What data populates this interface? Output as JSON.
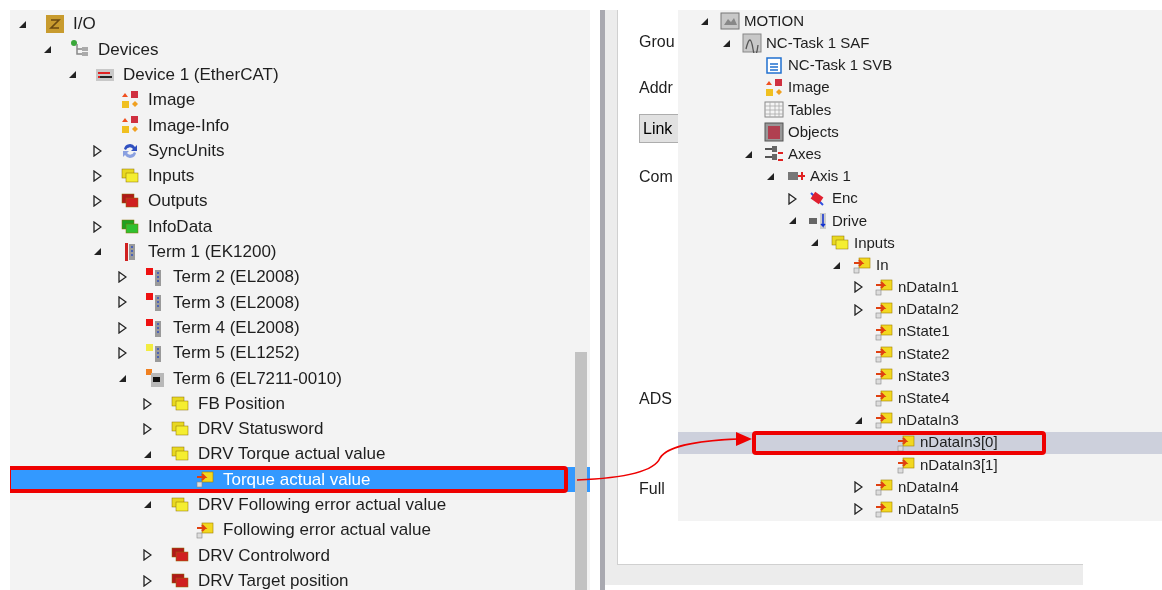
{
  "left_tree": {
    "items": [
      {
        "label": "I/O",
        "kind": "io",
        "expanded": true,
        "selected": false,
        "highlighted": false,
        "children": [
          {
            "label": "Devices",
            "kind": "devices",
            "expanded": true,
            "selected": false,
            "highlighted": false,
            "children": [
              {
                "label": "Device 1 (EtherCAT)",
                "kind": "device",
                "expanded": true,
                "selected": false,
                "highlighted": false,
                "children": [
                  {
                    "label": "Image",
                    "kind": "image",
                    "selected": false,
                    "highlighted": false
                  },
                  {
                    "label": "Image-Info",
                    "kind": "image",
                    "selected": false,
                    "highlighted": false
                  },
                  {
                    "label": "SyncUnits",
                    "kind": "sync",
                    "expanded": false,
                    "selected": false,
                    "highlighted": false
                  },
                  {
                    "label": "Inputs",
                    "kind": "inputs",
                    "expanded": false,
                    "selected": false,
                    "highlighted": false
                  },
                  {
                    "label": "Outputs",
                    "kind": "outputs",
                    "expanded": false,
                    "selected": false,
                    "highlighted": false
                  },
                  {
                    "label": "InfoData",
                    "kind": "info",
                    "expanded": false,
                    "selected": false,
                    "highlighted": false
                  },
                  {
                    "label": "Term 1 (EK1200)",
                    "kind": "coupler",
                    "expanded": true,
                    "selected": false,
                    "highlighted": false,
                    "children": [
                      {
                        "label": "Term 2 (EL2008)",
                        "kind": "term-out",
                        "expanded": false,
                        "selected": false,
                        "highlighted": false
                      },
                      {
                        "label": "Term 3 (EL2008)",
                        "kind": "term-out",
                        "expanded": false,
                        "selected": false,
                        "highlighted": false
                      },
                      {
                        "label": "Term 4 (EL2008)",
                        "kind": "term-out",
                        "expanded": false,
                        "selected": false,
                        "highlighted": false
                      },
                      {
                        "label": "Term 5 (EL1252)",
                        "kind": "term-in",
                        "expanded": false,
                        "selected": false,
                        "highlighted": false
                      },
                      {
                        "label": "Term 6 (EL7211-0010)",
                        "kind": "term-drive",
                        "expanded": true,
                        "selected": false,
                        "highlighted": false,
                        "children": [
                          {
                            "label": "FB Position",
                            "kind": "inputs",
                            "expanded": false,
                            "selected": false,
                            "highlighted": false
                          },
                          {
                            "label": "DRV Statusword",
                            "kind": "inputs",
                            "expanded": false,
                            "selected": false,
                            "highlighted": false
                          },
                          {
                            "label": "DRV Torque actual value",
                            "kind": "inputs",
                            "expanded": true,
                            "selected": false,
                            "highlighted": false,
                            "children": [
                              {
                                "label": "Torque actual value",
                                "kind": "variable",
                                "selected": true,
                                "highlighted": true
                              }
                            ]
                          },
                          {
                            "label": "DRV Following error actual value",
                            "kind": "inputs",
                            "expanded": true,
                            "selected": false,
                            "highlighted": false,
                            "children": [
                              {
                                "label": "Following error actual value",
                                "kind": "variable",
                                "selected": false,
                                "highlighted": false
                              }
                            ]
                          },
                          {
                            "label": "DRV Controlword",
                            "kind": "outputs",
                            "expanded": false,
                            "selected": false,
                            "highlighted": false
                          },
                          {
                            "label": "DRV Target position",
                            "kind": "outputs",
                            "expanded": false,
                            "selected": false,
                            "highlighted": false
                          }
                        ]
                      }
                    ]
                  }
                ]
              }
            ]
          }
        ]
      }
    ]
  },
  "properties": [
    {
      "kind": "label",
      "text": "Grou"
    },
    {
      "kind": "label",
      "text": "Addr"
    },
    {
      "kind": "button",
      "text": "Link"
    },
    {
      "kind": "label",
      "text": "Com"
    },
    {
      "kind": "label",
      "text": "ADS"
    },
    {
      "kind": "label",
      "text": "Full"
    }
  ],
  "right_tree": {
    "items": [
      {
        "label": "MOTION",
        "kind": "motion",
        "expanded": true,
        "selected": false,
        "highlighted": false,
        "children": [
          {
            "label": "NC-Task 1 SAF",
            "kind": "nctask",
            "expanded": true,
            "selected": false,
            "highlighted": false,
            "children": [
              {
                "label": "NC-Task 1 SVB",
                "kind": "svb",
                "selected": false,
                "highlighted": false
              },
              {
                "label": "Image",
                "kind": "image",
                "selected": false,
                "highlighted": false
              },
              {
                "label": "Tables",
                "kind": "tables",
                "selected": false,
                "highlighted": false
              },
              {
                "label": "Objects",
                "kind": "objects",
                "selected": false,
                "highlighted": false
              },
              {
                "label": "Axes",
                "kind": "axes",
                "expanded": true,
                "selected": false,
                "highlighted": false,
                "children": [
                  {
                    "label": "Axis 1",
                    "kind": "axis",
                    "expanded": true,
                    "selected": false,
                    "highlighted": false,
                    "children": [
                      {
                        "label": "Enc",
                        "kind": "enc",
                        "expanded": false,
                        "selected": false,
                        "highlighted": false
                      },
                      {
                        "label": "Drive",
                        "kind": "drive",
                        "expanded": true,
                        "selected": false,
                        "highlighted": false,
                        "children": [
                          {
                            "label": "Inputs",
                            "kind": "inputs",
                            "expanded": true,
                            "selected": false,
                            "highlighted": false,
                            "children": [
                              {
                                "label": "In",
                                "kind": "variable",
                                "expanded": true,
                                "selected": false,
                                "highlighted": false,
                                "children": [
                                  {
                                    "label": "nDataIn1",
                                    "kind": "variable",
                                    "expanded": false,
                                    "selected": false,
                                    "highlighted": false
                                  },
                                  {
                                    "label": "nDataIn2",
                                    "kind": "variable",
                                    "expanded": false,
                                    "selected": false,
                                    "highlighted": false
                                  },
                                  {
                                    "label": "nState1",
                                    "kind": "variable",
                                    "selected": false,
                                    "highlighted": false
                                  },
                                  {
                                    "label": "nState2",
                                    "kind": "variable",
                                    "selected": false,
                                    "highlighted": false
                                  },
                                  {
                                    "label": "nState3",
                                    "kind": "variable",
                                    "selected": false,
                                    "highlighted": false
                                  },
                                  {
                                    "label": "nState4",
                                    "kind": "variable",
                                    "selected": false,
                                    "highlighted": false
                                  },
                                  {
                                    "label": "nDataIn3",
                                    "kind": "variable",
                                    "expanded": true,
                                    "selected": false,
                                    "highlighted": false,
                                    "children": [
                                      {
                                        "label": "nDataIn3[0]",
                                        "kind": "variable",
                                        "selected": true,
                                        "highlighted": true
                                      },
                                      {
                                        "label": "nDataIn3[1]",
                                        "kind": "variable",
                                        "selected": false,
                                        "highlighted": false
                                      }
                                    ]
                                  },
                                  {
                                    "label": "nDataIn4",
                                    "kind": "variable",
                                    "expanded": false,
                                    "selected": false,
                                    "highlighted": false
                                  },
                                  {
                                    "label": "nDataIn5",
                                    "kind": "variable",
                                    "expanded": false,
                                    "selected": false,
                                    "highlighted": false
                                  }
                                ]
                              }
                            ]
                          }
                        ]
                      }
                    ]
                  }
                ]
              }
            ]
          }
        ]
      }
    ]
  }
}
